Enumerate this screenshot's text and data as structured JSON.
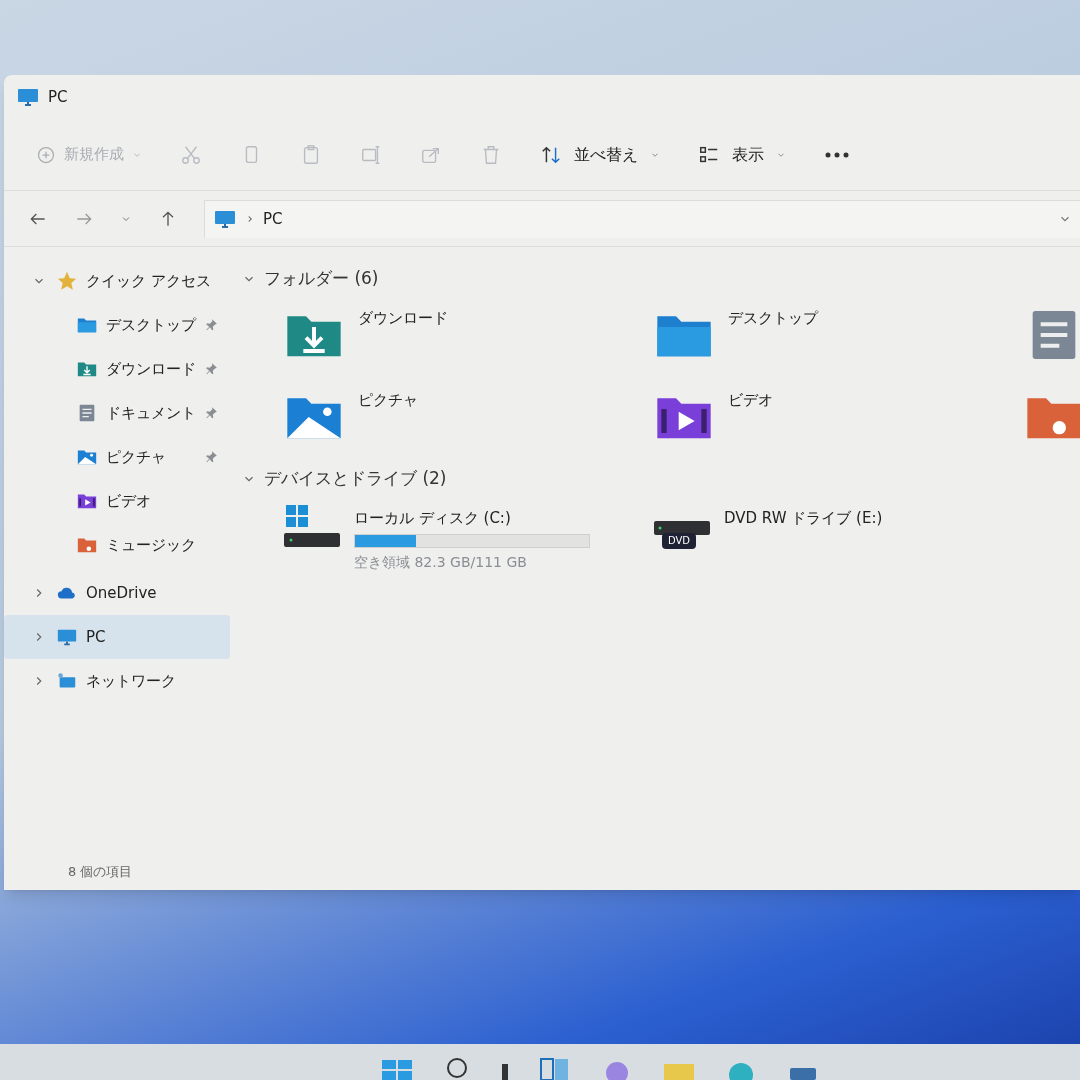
{
  "window": {
    "title": "PC"
  },
  "toolbar": {
    "new_button": {
      "label": "新規作成",
      "disabled": true
    },
    "icon_buttons": [
      {
        "kind": "cut",
        "disabled": true
      },
      {
        "kind": "copy",
        "disabled": true
      },
      {
        "kind": "paste",
        "disabled": true
      },
      {
        "kind": "rename",
        "disabled": true
      },
      {
        "kind": "share",
        "disabled": true
      },
      {
        "kind": "delete",
        "disabled": true
      }
    ],
    "sort_button": {
      "label": "並べ替え"
    },
    "view_button": {
      "label": "表示"
    }
  },
  "address_bar": {
    "path": [
      "PC"
    ]
  },
  "sidebar": {
    "items": [
      {
        "label": "クイック アクセス",
        "kind": "star",
        "expanded": true,
        "selected": false,
        "children": [
          {
            "label": "デスクトップ",
            "kind": "desktop",
            "pinned": true,
            "selected": false
          },
          {
            "label": "ダウンロード",
            "kind": "downloads",
            "pinned": true,
            "selected": false
          },
          {
            "label": "ドキュメント",
            "kind": "documents",
            "pinned": true,
            "selected": false
          },
          {
            "label": "ピクチャ",
            "kind": "pictures",
            "pinned": true,
            "selected": false
          },
          {
            "label": "ビデオ",
            "kind": "videos",
            "pinned": false,
            "selected": false
          },
          {
            "label": "ミュージック",
            "kind": "music",
            "pinned": false,
            "selected": false
          }
        ]
      },
      {
        "label": "OneDrive",
        "kind": "cloud",
        "expanded": false,
        "selected": false
      },
      {
        "label": "PC",
        "kind": "pc",
        "expanded": false,
        "selected": true
      },
      {
        "label": "ネットワーク",
        "kind": "network",
        "expanded": false,
        "selected": false
      }
    ]
  },
  "sections": [
    {
      "title": "フォルダー (6)",
      "expanded": true,
      "items": [
        {
          "label": "ダウンロード",
          "kind": "downloads"
        },
        {
          "label": "デスクトップ",
          "kind": "desktop"
        },
        {
          "kind": "documents"
        },
        {
          "label": "ピクチャ",
          "kind": "pictures"
        },
        {
          "label": "ビデオ",
          "kind": "videos"
        },
        {
          "kind": "music"
        }
      ]
    },
    {
      "title": "デバイスとドライブ (2)",
      "expanded": true,
      "items": [
        {
          "label": "ローカル ディスク (C:)",
          "kind": "disk",
          "level": 0.26,
          "free": "空き領域 82.3 GB/111 GB"
        },
        {
          "label": "DVD RW ドライブ (E:)",
          "kind": "dvd",
          "badge": "DVD"
        }
      ]
    }
  ],
  "status_bar": {
    "text": "8 個の項目"
  }
}
